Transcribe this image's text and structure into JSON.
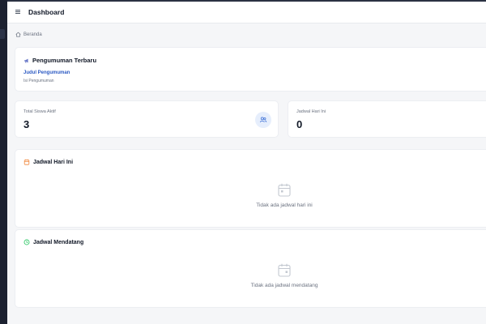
{
  "header": {
    "title": "Dashboard",
    "menu_icon": "hamburger-icon"
  },
  "breadcrumb": {
    "home_icon": "home-icon",
    "label": "Beranda"
  },
  "announcement": {
    "icon": "megaphone-icon",
    "title": "Pengumuman Terbaru",
    "item_title": "Judul Pengumuman",
    "item_body": "Isi Pengumuman"
  },
  "stats": {
    "students": {
      "label": "Total Siswa Aktif",
      "value": "3",
      "icon": "users-icon"
    },
    "schedule": {
      "label": "Jadwal Hari Ini",
      "value": "0"
    }
  },
  "today_schedule": {
    "icon": "calendar-icon",
    "title": "Jadwal Hari Ini",
    "empty_icon": "calendar-empty-icon",
    "empty_text": "Tidak ada jadwal hari ini"
  },
  "upcoming_schedule": {
    "icon": "clock-icon",
    "title": "Jadwal Mendatang",
    "empty_icon": "calendar-empty-icon",
    "empty_text": "Tidak ada jadwal mendatang"
  },
  "colors": {
    "accent": "#2b59c3",
    "today_icon": "#f0883e",
    "upcoming_icon": "#22c55e",
    "background": "#f5f6f8"
  }
}
